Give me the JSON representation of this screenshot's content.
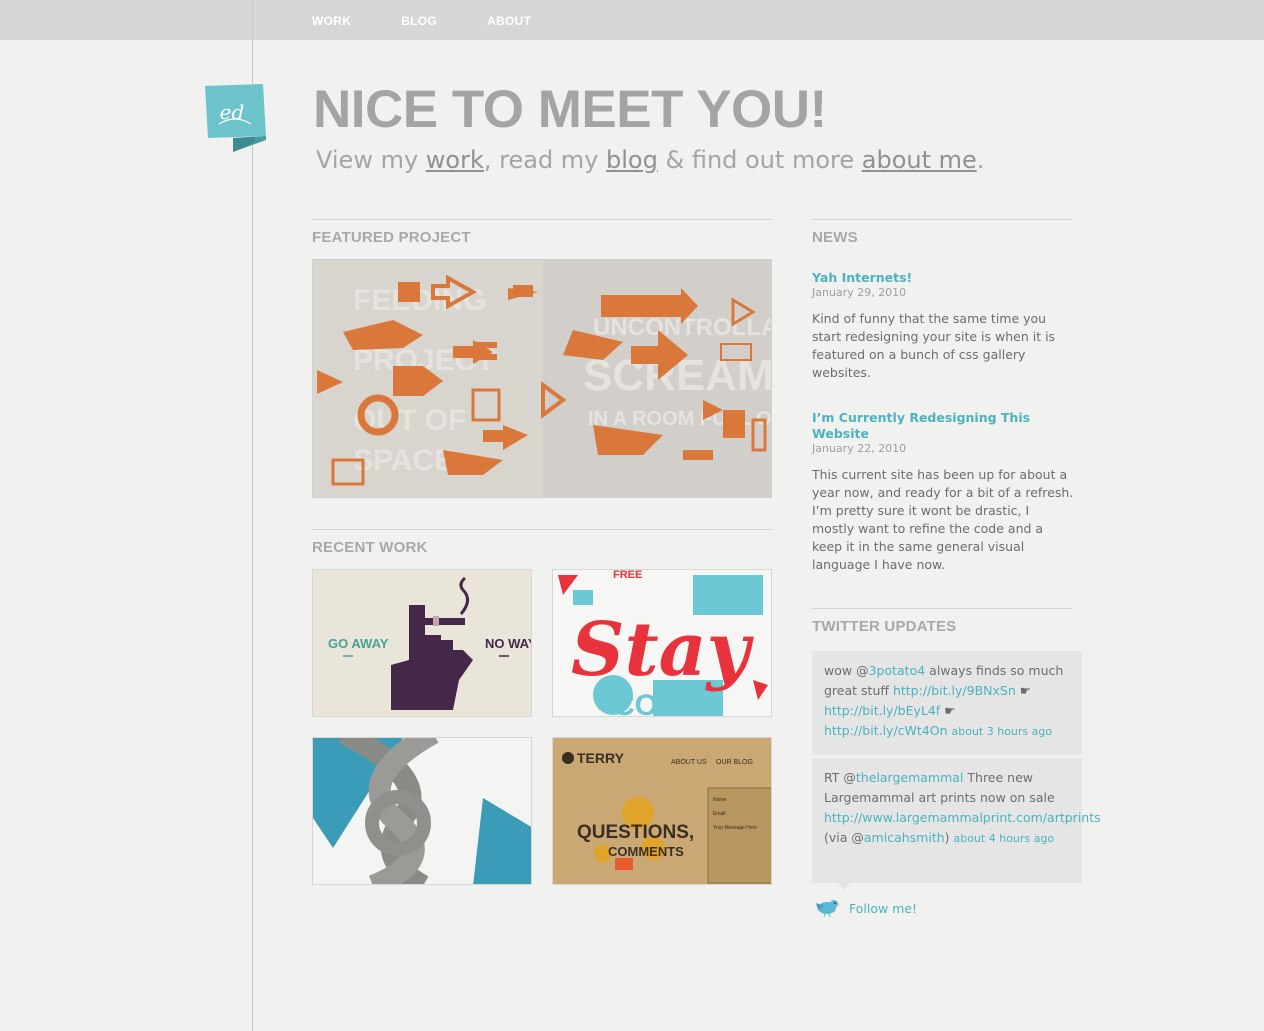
{
  "nav": {
    "items": [
      "WORK",
      "BLOG",
      "ABOUT"
    ]
  },
  "logo": {
    "text": "ed"
  },
  "hero": {
    "headline": "NICE TO MEET YOU!",
    "sub_view": "View my ",
    "sub_work": "work",
    "sub_read": ", read my ",
    "sub_blog": "blog",
    "sub_find": " & find out more ",
    "sub_about": "about me",
    "sub_end": "."
  },
  "featured": {
    "title": "FEATURED PROJECT"
  },
  "recent": {
    "title": "RECENT WORK",
    "thumb1_left": "GO AWAY",
    "thumb1_right": "NO WAY",
    "thumb2_text": "Stay",
    "thumb2_sub": "COOL",
    "thumb2_free": "FREE",
    "thumb4_logo": "TERRY",
    "thumb4_q": "QUESTIONS,",
    "thumb4_c": "COMMENTS",
    "thumb4_nav1": "ABOUT US",
    "thumb4_nav2": "OUR BLOG",
    "thumb4_field1": "Name",
    "thumb4_field2": "Email",
    "thumb4_field3": "Your Message Here"
  },
  "news": {
    "title": "NEWS",
    "items": [
      {
        "title": "Yah Internets!",
        "date": "January 29, 2010",
        "body": "Kind of funny that the same time you start redesigning your site is when it is featured on a bunch of css gallery websites."
      },
      {
        "title": "I’m Currently Redesigning This Website",
        "date": "January 22, 2010",
        "body": "This current site has been up for about a year now, and ready for a bit of a refresh. I’m pretty sure it wont be drastic, I mostly want to refine the code and a keep it in the same general visual language I have now."
      }
    ]
  },
  "twitter": {
    "title": "TWITTER UPDATES",
    "tweet1": {
      "t1": "wow @",
      "u1": "3potato4",
      "t2": " always finds so much great stuff ",
      "l1": "http://bit.ly/9BNxSn",
      "sep1": " ☛ ",
      "l2": "http://bit.ly/bEyL4f",
      "sep2": " ☛ ",
      "l3": "http://bit.ly/cWt4On",
      "time": "about 3 hours ago"
    },
    "tweet2": {
      "t1": "RT @",
      "u1": "thelargemammal",
      "t2": " Three new Largemammal art prints now on sale ",
      "l1": "http://www.largemammalprint.com/artprints",
      "t3": " (via @",
      "u2": "amicahsmith",
      "t4": ") ",
      "time": "about 4 hours ago"
    },
    "follow": "Follow me!"
  },
  "colors": {
    "accent": "#4ab3bf",
    "headline": "#a3a5a5",
    "topbar": "#d4d7d6",
    "background": "#f1f1ef"
  }
}
